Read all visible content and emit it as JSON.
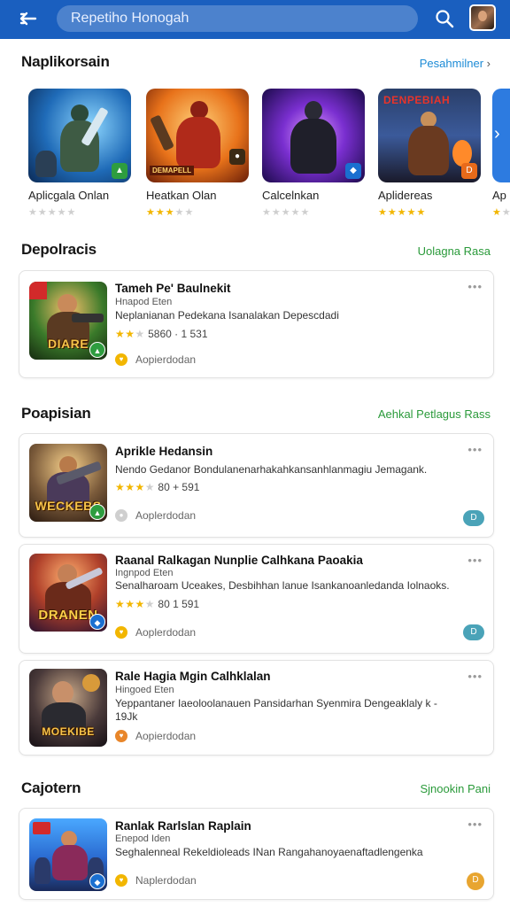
{
  "header": {
    "search_text": "Repetiho Honogah",
    "icons": {
      "back": "back-arrow-icon",
      "search": "search-icon",
      "avatar": "avatar"
    },
    "colors": {
      "bar": "#1a5fbf"
    }
  },
  "section_featured": {
    "title": "Naplikorsain",
    "link": "Pesahmilner",
    "tiles": [
      {
        "name": "Aplicgala Onlan",
        "rating_stars": 0
      },
      {
        "name": "Heatkan Olan",
        "rating_stars": 3
      },
      {
        "name": "Calcelnkan",
        "rating_stars": 0
      },
      {
        "name": "Aplidereas",
        "rating_stars": 5
      },
      {
        "name": "Ap",
        "rating_stars": 1
      }
    ],
    "tile_art_text": {
      "tile2": "DEMAPELL",
      "tile4": "DENPEBIAH"
    }
  },
  "section_deplorais": {
    "title": "Depolracis",
    "link": "Uolagna Rasa",
    "card": {
      "title": "Tameh Pe' Baulnekit",
      "subtitle": "Hnapod Eten",
      "description": "Neplanianan Pedekana Isanalakan Depescdadi",
      "rating_stars": 2,
      "rating_text": "5860 · 1 531",
      "developer": "Aopierdodan",
      "art_caption": "DIARE"
    }
  },
  "section_popular": {
    "title": "Poapisian",
    "link": "Aehkal Petlagus Rass",
    "cards": [
      {
        "title": "Aprikle Hedansin",
        "subtitle": "",
        "description": "Nendo Gedanor Bondulanenarhakahkansanhlanmagiu Jemagank.",
        "rating_stars": 3,
        "rating_text": "80 + 591",
        "developer": "Aoplerdodan",
        "art_caption": "WECKEBS"
      },
      {
        "title": "Raanal Ralkagan Nunplie Calhkana Paoakia",
        "subtitle": "Ingnpod Eten",
        "description": "Senalharoam Uceakes, Desbihhan lanue Isankanoanledanda Iolnaoks.",
        "rating_stars": 3,
        "rating_text": "80 1 591",
        "developer": "Aoplerdodan",
        "art_caption": "DRANEN"
      },
      {
        "title": "Rale Hagia Mgin Calhklalan",
        "subtitle": "Hingoed Eten",
        "description": "Yeppantaner Iaeoloolanauen Pansidarhan Syenmira Dengeaklaly k -",
        "description_2": "19Jk",
        "rating_stars": 0,
        "rating_text": "",
        "developer": "Aopierdodan",
        "art_caption": "MOEKIBE"
      }
    ]
  },
  "section_cajotern": {
    "title": "Cajotern",
    "link": "Sjnookin Pani",
    "card": {
      "title": "Ranlak Rarlslan Raplain",
      "subtitle": "Enepod Iden",
      "description": "Seghalenneal Rekeldioleads INan Rangahanoyaenaftadlengenka",
      "developer": "Naplerdodan"
    }
  },
  "colors": {
    "star": "#f2b600",
    "green_link": "#2a9a3a",
    "blue_link": "#1c8bd6",
    "chip_teal": "#4aa3b8",
    "chip_orange": "#e8a530"
  }
}
